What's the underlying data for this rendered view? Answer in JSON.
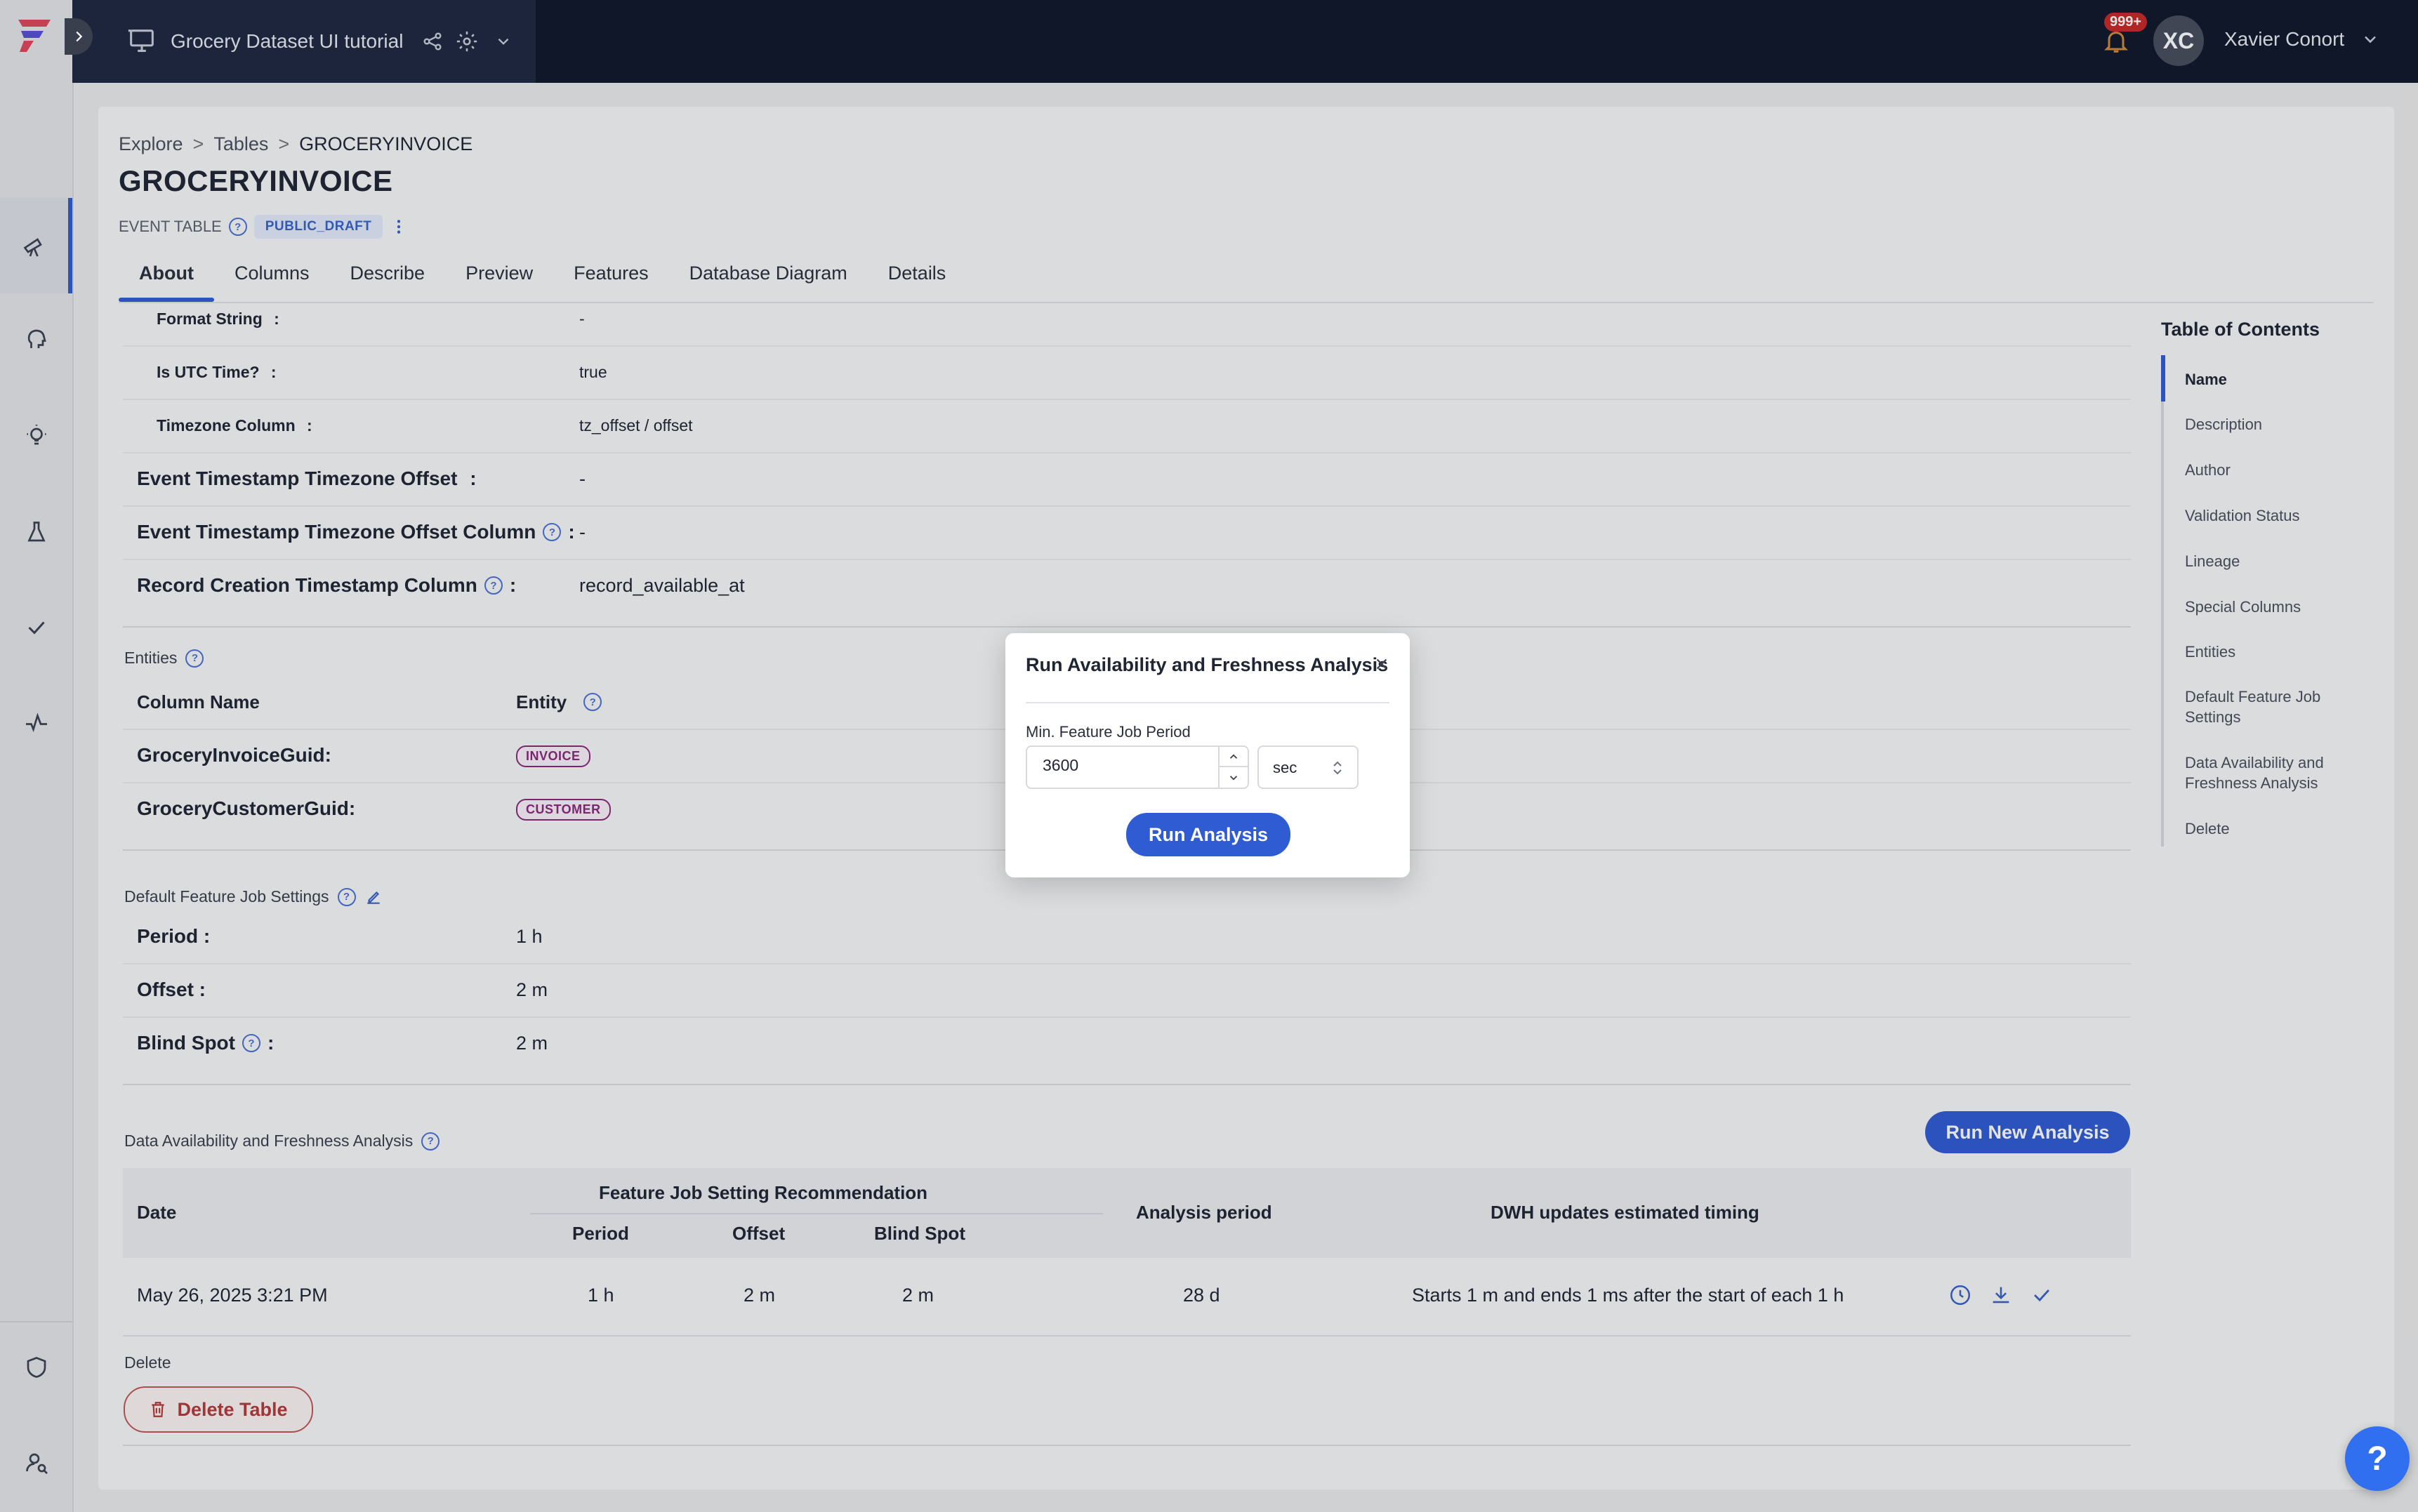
{
  "app": {
    "project_title": "Grocery Dataset UI tutorial",
    "notifications_badge": "999+",
    "user_initials": "XC",
    "user_name": "Xavier Conort",
    "accent_color": "#2f5bd3"
  },
  "breadcrumb": {
    "items": [
      "Explore",
      "Tables",
      "GROCERYINVOICE"
    ],
    "separator": ">"
  },
  "page": {
    "title": "GROCERYINVOICE",
    "table_type": "EVENT TABLE",
    "status": "PUBLIC_DRAFT"
  },
  "tabs": [
    "About",
    "Columns",
    "Describe",
    "Preview",
    "Features",
    "Database Diagram",
    "Details"
  ],
  "active_tab": "About",
  "timestamp_details": [
    {
      "label": "Format String",
      "value": "-"
    },
    {
      "label": "Is UTC Time?",
      "value": "true"
    },
    {
      "label": "Timezone Column",
      "value": "tz_offset / offset"
    }
  ],
  "special_columns": [
    {
      "label": "Event Timestamp Timezone Offset",
      "value": "-"
    },
    {
      "label": "Event Timestamp Timezone Offset Column",
      "value": "-"
    },
    {
      "label": "Record Creation Timestamp Column",
      "value": "record_available_at"
    }
  ],
  "entities": {
    "section_label": "Entities",
    "col_header": "Column Name",
    "entity_header": "Entity",
    "rows": [
      {
        "column": "GroceryInvoiceGuid:",
        "entity": "INVOICE"
      },
      {
        "column": "GroceryCustomerGuid:",
        "entity": "CUSTOMER"
      }
    ]
  },
  "feature_job": {
    "section_label": "Default Feature Job Settings",
    "rows": [
      {
        "label": "Period :",
        "value": "1 h"
      },
      {
        "label": "Offset :",
        "value": "2 m"
      },
      {
        "label": "Blind Spot",
        "value": "2 m"
      }
    ]
  },
  "analysis": {
    "section_label": "Data Availability and Freshness Analysis",
    "run_new_label": "Run New Analysis",
    "headers": {
      "date": "Date",
      "recommendation": "Feature Job Setting Recommendation",
      "period": "Period",
      "offset": "Offset",
      "blind_spot": "Blind Spot",
      "analysis_period": "Analysis period",
      "dwh": "DWH updates estimated timing"
    },
    "row": {
      "date": "May 26, 2025 3:21 PM",
      "period": "1 h",
      "offset": "2 m",
      "blind_spot": "2 m",
      "analysis_period": "28 d",
      "dwh": "Starts 1 m and ends 1 ms after the start of each 1 h"
    }
  },
  "delete": {
    "section_label": "Delete",
    "button_label": "Delete Table"
  },
  "toc": {
    "title": "Table of Contents",
    "items": [
      "Name",
      "Description",
      "Author",
      "Validation Status",
      "Lineage",
      "Special Columns",
      "Entities",
      "Default Feature Job Settings",
      "Data Availability and Freshness Analysis",
      "Delete"
    ],
    "active": "Name"
  },
  "modal": {
    "title": "Run Availability and Freshness Analysis",
    "field_label": "Min. Feature Job Period",
    "field_value": "3600",
    "unit_value": "sec",
    "run_label": "Run Analysis"
  },
  "help_label": "?"
}
